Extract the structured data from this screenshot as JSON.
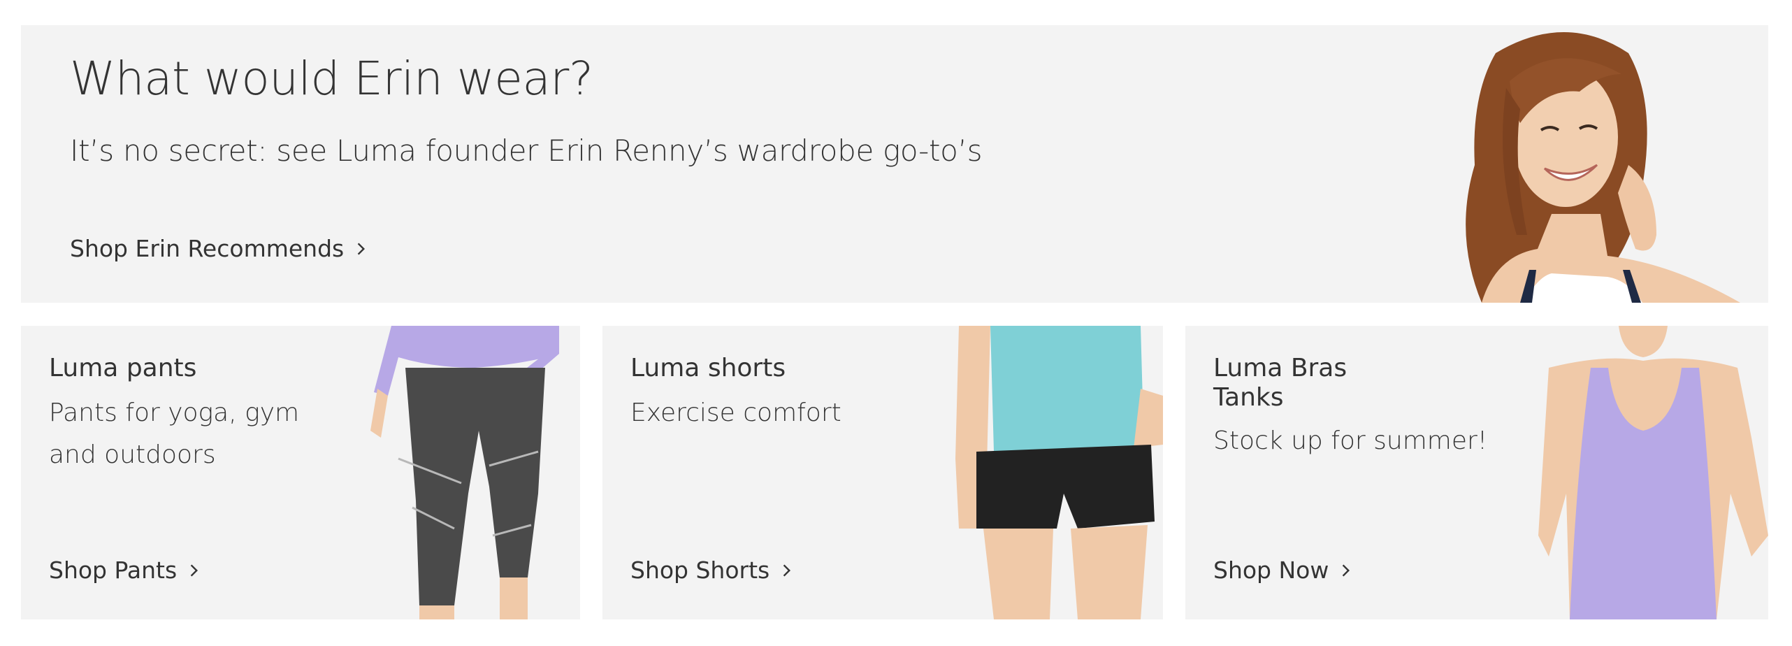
{
  "hero": {
    "title": "What would Erin wear?",
    "subtitle": "It’s no secret: see Luma founder Erin Renny’s wardrobe go-to’s",
    "cta": "Shop Erin Recommends"
  },
  "cards": [
    {
      "title": "Luma pants",
      "description": "Pants for yoga, gym and outdoors",
      "cta": "Shop Pants"
    },
    {
      "title": "Luma shorts",
      "description": "Exercise comfort",
      "cta": "Shop Shorts"
    },
    {
      "title": "Luma Bras Tanks",
      "description": "Stock up for summer!",
      "cta": "Shop Now"
    }
  ],
  "colors": {
    "panel_bg": "#f3f3f3",
    "text": "#333333",
    "lavender": "#b7a8e6",
    "aqua": "#7fd0d6",
    "charcoal": "#4a4a4a"
  },
  "icons": [
    "chevron-right-icon"
  ]
}
